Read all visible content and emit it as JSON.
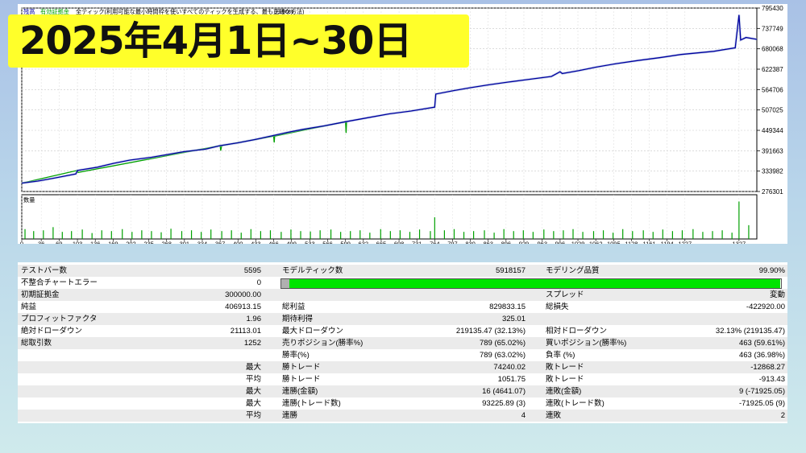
{
  "headline": "2025年4月1日~30日",
  "chart_data": [
    {
      "type": "line",
      "title": "",
      "legend": [
        "残高",
        "有効証拠金",
        "全ティック(利用可能な最小時間枠を使いすべてのティックを生成する、最も正確な方法)",
        "99.90%"
      ],
      "legend_colors": [
        "#0000a0",
        "#00a000",
        "#000000",
        "#000000"
      ],
      "y_ticks": [
        "795430",
        "737749",
        "680068",
        "622387",
        "564706",
        "507025",
        "449344",
        "391663",
        "333982",
        "276301"
      ],
      "ylim": [
        276301,
        795430
      ],
      "xlim": [
        0,
        1360
      ],
      "series": [
        {
          "name": "残高",
          "x": [
            0,
            30,
            60,
            100,
            103,
            140,
            170,
            200,
            240,
            270,
            300,
            340,
            367,
            400,
            430,
            460,
            490,
            520,
            560,
            600,
            640,
            680,
            720,
            764,
            766,
            800,
            830,
            863,
            900,
            940,
            980,
            996,
            1000,
            1030,
            1062,
            1100,
            1140,
            1180,
            1220,
            1280,
            1320,
            1327,
            1330,
            1340,
            1360
          ],
          "values": [
            300000,
            306000,
            314000,
            326000,
            336000,
            345000,
            356000,
            365000,
            373000,
            381000,
            389000,
            396000,
            406000,
            414000,
            423000,
            433000,
            443000,
            452000,
            462000,
            474000,
            485000,
            496000,
            504000,
            515000,
            552000,
            562000,
            570000,
            578000,
            586000,
            594000,
            602000,
            615000,
            610000,
            618000,
            628000,
            638000,
            647000,
            655000,
            664000,
            673000,
            683000,
            776000,
            705000,
            712000,
            706913
          ]
        },
        {
          "name": "有効証拠金",
          "x": [
            0,
            103,
            104,
            367,
            368,
            370,
            466,
            467,
            468,
            599,
            600,
            601
          ],
          "values": [
            300000,
            336000,
            330000,
            406000,
            392000,
            406000,
            433000,
            415000,
            433000,
            474000,
            442000,
            474000
          ]
        }
      ],
      "grid": true
    },
    {
      "type": "bar",
      "title": "",
      "legend": [
        "数量"
      ],
      "x_ticks": [
        "0",
        "36",
        "69",
        "103",
        "136",
        "169",
        "202",
        "235",
        "268",
        "301",
        "334",
        "367",
        "400",
        "433",
        "466",
        "499",
        "533",
        "566",
        "599",
        "632",
        "665",
        "698",
        "731",
        "764",
        "797",
        "830",
        "863",
        "896",
        "929",
        "963",
        "996",
        "1029",
        "1062",
        "1095",
        "1128",
        "1161",
        "1194",
        "1227",
        "1327"
      ],
      "xlim": [
        0,
        1360
      ],
      "ylim": [
        0,
        1
      ],
      "x": [
        6,
        22,
        40,
        58,
        75,
        92,
        112,
        130,
        148,
        166,
        186,
        204,
        222,
        240,
        258,
        276,
        296,
        314,
        332,
        350,
        370,
        388,
        406,
        424,
        442,
        460,
        480,
        498,
        516,
        534,
        552,
        572,
        590,
        608,
        626,
        644,
        664,
        682,
        700,
        718,
        736,
        756,
        764,
        782,
        800,
        818,
        836,
        856,
        874,
        892,
        910,
        928,
        946,
        966,
        984,
        1002,
        1020,
        1038,
        1058,
        1076,
        1094,
        1112,
        1130,
        1150,
        1168,
        1186,
        1204,
        1222,
        1242,
        1260,
        1278,
        1296,
        1314,
        1327,
        1345
      ],
      "values": [
        0.25,
        0.2,
        0.22,
        0.3,
        0.18,
        0.2,
        0.24,
        0.15,
        0.22,
        0.2,
        0.25,
        0.18,
        0.22,
        0.2,
        0.17,
        0.26,
        0.2,
        0.22,
        0.18,
        0.24,
        0.2,
        0.22,
        0.16,
        0.25,
        0.2,
        0.22,
        0.18,
        0.24,
        0.2,
        0.19,
        0.22,
        0.24,
        0.18,
        0.2,
        0.22,
        0.16,
        0.25,
        0.2,
        0.22,
        0.18,
        0.24,
        0.2,
        0.55,
        0.22,
        0.25,
        0.18,
        0.2,
        0.22,
        0.16,
        0.25,
        0.2,
        0.22,
        0.18,
        0.24,
        0.2,
        0.22,
        0.25,
        0.18,
        0.2,
        0.22,
        0.16,
        0.25,
        0.2,
        0.22,
        0.18,
        0.24,
        0.2,
        0.22,
        0.25,
        0.18,
        0.2,
        0.22,
        0.16,
        0.95,
        0.35
      ]
    }
  ],
  "report": {
    "rows": [
      [
        "テストバー数",
        "5595",
        "モデルティック数",
        "5918157",
        "モデリング品質",
        "99.90%"
      ],
      [
        "不整合チャートエラー",
        "0",
        "",
        "",
        "",
        ""
      ],
      [
        "初期証拠金",
        "300000.00",
        "",
        "",
        "スプレッド",
        "変動"
      ],
      [
        "純益",
        "406913.15",
        "総利益",
        "829833.15",
        "総損失",
        "-422920.00"
      ],
      [
        "プロフィットファクタ",
        "1.96",
        "期待利得",
        "325.01",
        "",
        ""
      ],
      [
        "絶対ドローダウン",
        "21113.01",
        "最大ドローダウン",
        "219135.47 (32.13%)",
        "相対ドローダウン",
        "32.13% (219135.47)"
      ],
      [
        "総取引数",
        "1252",
        "売りポジション(勝率%)",
        "789 (65.02%)",
        "買いポジション(勝率%)",
        "463 (59.61%)"
      ],
      [
        "",
        "",
        "勝率(%)",
        "789 (63.02%)",
        "負率 (%)",
        "463 (36.98%)"
      ],
      [
        "",
        "最大",
        "勝トレード",
        "74240.02",
        "敗トレード",
        "-12868.27"
      ],
      [
        "",
        "平均",
        "勝トレード",
        "1051.75",
        "敗トレード",
        "-913.43"
      ],
      [
        "",
        "最大",
        "連勝(金額)",
        "16 (4641.07)",
        "連敗(金額)",
        "9 (-71925.05)"
      ],
      [
        "",
        "最大",
        "連勝(トレード数)",
        "93225.89 (3)",
        "連敗(トレード数)",
        "-71925.05 (9)"
      ],
      [
        "",
        "平均",
        "連勝",
        "4",
        "連敗",
        "2"
      ]
    ],
    "quality_bar_fraction": 0.999,
    "quality_bar_color": "#00e400"
  }
}
